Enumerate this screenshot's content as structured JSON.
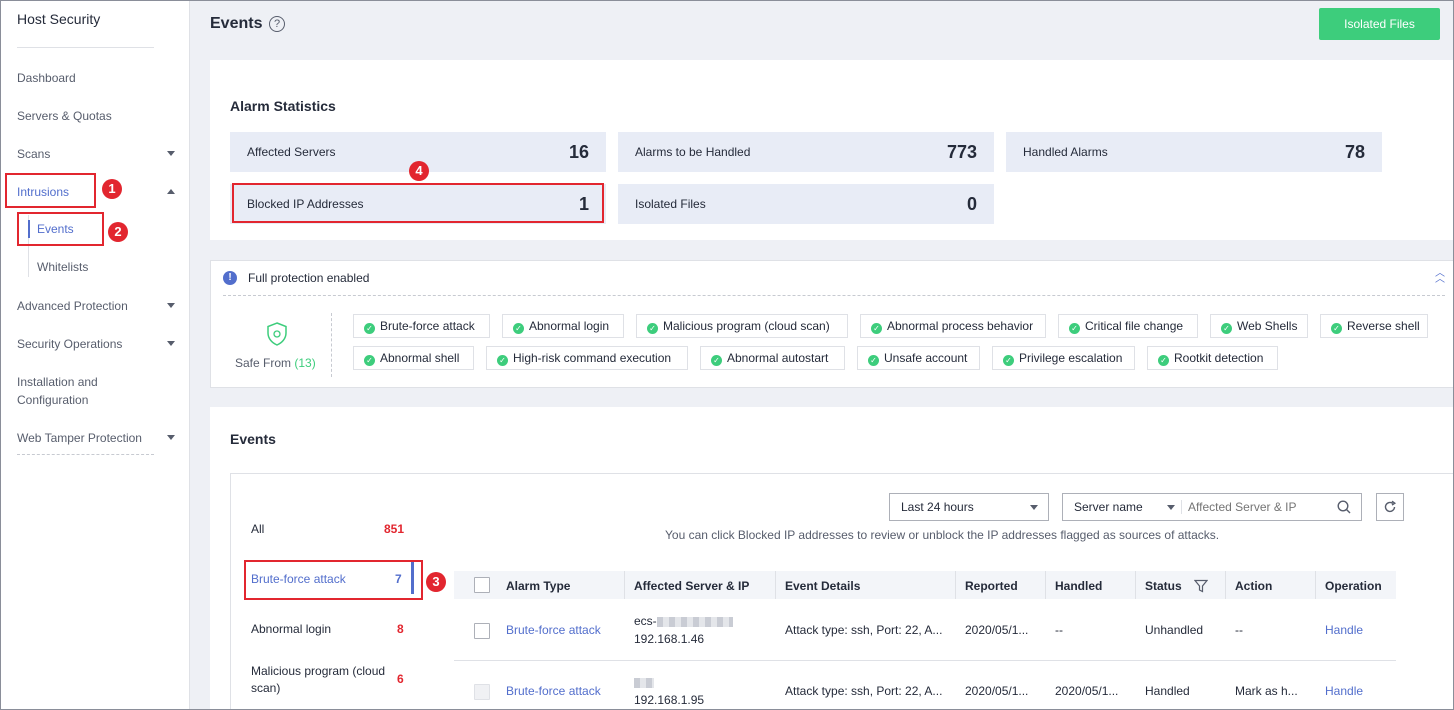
{
  "sidebar": {
    "title": "Host Security",
    "items": [
      {
        "label": "Dashboard"
      },
      {
        "label": "Servers & Quotas"
      },
      {
        "label": "Scans"
      },
      {
        "label": "Intrusions"
      },
      {
        "label": "Events"
      },
      {
        "label": "Whitelists"
      },
      {
        "label": "Advanced Protection"
      },
      {
        "label": "Security Operations"
      },
      {
        "label": "Installation and Configuration"
      },
      {
        "label": "Web Tamper Protection"
      }
    ]
  },
  "header": {
    "title": "Events",
    "help_icon": "question-circle-icon",
    "isolated_files_button": "Isolated Files"
  },
  "annotations": {
    "b1": "1",
    "b2": "2",
    "b3": "3",
    "b4": "4"
  },
  "alarm_stats": {
    "title": "Alarm Statistics",
    "cards": [
      {
        "label": "Affected Servers",
        "value": "16"
      },
      {
        "label": "Alarms to be Handled",
        "value": "773"
      },
      {
        "label": "Handled Alarms",
        "value": "78"
      },
      {
        "label": "Blocked IP Addresses",
        "value": "1"
      },
      {
        "label": "Isolated Files",
        "value": "0"
      }
    ]
  },
  "protection": {
    "status": "Full protection enabled",
    "safe_from_label": "Safe From",
    "safe_from_count": "(13)",
    "tags": [
      "Brute-force attack",
      "Abnormal login",
      "Malicious program (cloud scan)",
      "Abnormal process behavior",
      "Critical file change",
      "Web Shells",
      "Reverse shell",
      "Abnormal shell",
      "High-risk command execution",
      "Abnormal autostart",
      "Unsafe account",
      "Privilege escalation",
      "Rootkit detection"
    ]
  },
  "events": {
    "title": "Events",
    "categories": [
      {
        "label": "All",
        "count": "851"
      },
      {
        "label": "Brute-force attack",
        "count": "7"
      },
      {
        "label": "Abnormal login",
        "count": "8"
      },
      {
        "label": "Malicious program (cloud scan)",
        "count": "6"
      }
    ],
    "time_filter": "Last 24 hours",
    "server_filter": "Server name",
    "search_placeholder": "Affected Server & IP",
    "hint": "You can click Blocked IP addresses to review or unblock the IP addresses flagged as sources of attacks.",
    "columns": [
      "Alarm Type",
      "Affected Server & IP",
      "Event Details",
      "Reported",
      "Handled",
      "Status",
      "Action",
      "Operation"
    ],
    "rows": [
      {
        "alarm_type": "Brute-force attack",
        "server": "ecs-",
        "ip": "192.168.1.46",
        "details": "Attack type: ssh, Port: 22, A...",
        "reported": "2020/05/1...",
        "handled": "--",
        "status": "Unhandled",
        "action": "--",
        "operation": "Handle"
      },
      {
        "alarm_type": "Brute-force attack",
        "server": "",
        "ip": "192.168.1.95",
        "details": "Attack type: ssh, Port: 22, A...",
        "reported": "2020/05/1...",
        "handled": "2020/05/1...",
        "status": "Handled",
        "action": "Mark as h...",
        "operation": "Handle"
      }
    ]
  }
}
